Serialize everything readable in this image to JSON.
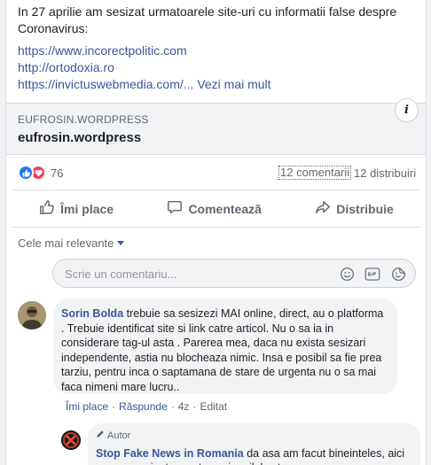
{
  "post": {
    "text_line1": "In 27 aprilie am sesizat urmatoarele site-uri cu informatii false despre",
    "text_line2": "Coronavirus:",
    "links": [
      "https://www.incorectpolitic.com",
      "http://ortodoxia.ro",
      "https://invictuswebmedia.com/..."
    ],
    "see_more": "Vezi mai mult"
  },
  "link_preview": {
    "domain": "EUFROSIN.WORDPRESS",
    "title": "eufrosin.wordpress",
    "info_icon": "i"
  },
  "stats": {
    "reactions_count": "76",
    "comments_count": "12 comentarii",
    "shares_count": "12 distribuiri"
  },
  "actions": {
    "like": "Îmi place",
    "comment": "Comentează",
    "share": "Distribuie"
  },
  "comments_section": {
    "sort_label": "Cele mai relevante",
    "composer_placeholder": "Scrie un comentariu..."
  },
  "comment": {
    "author": "Sorin Bolda",
    "text": "trebuie sa sesizezi MAI online, direct, au o platforma . Trebuie identificat site si link catre articol. Nu o sa ia in considerare tag-ul asta . Parerea mea, daca nu exista sesizari independente, astia nu blocheaza nimic. Insa e posibil sa fie prea tarziu, pentru inca o saptamana de stare de urgenta nu o sa mai faca nimeni mare lucru..",
    "like_label": "Îmi place",
    "reply_label": "Răspunde",
    "time": "4z",
    "edited": "Editat"
  },
  "reply": {
    "badge": "Autor",
    "author": "Stop Fake News in Romania",
    "text": "da asa am facut bineinteles, aici am pus varianta scurta caci mailul catre"
  },
  "colors": {
    "link": "#385898",
    "like_blue": "#2078f4",
    "love_red": "#f33e58",
    "muted": "#606770"
  }
}
